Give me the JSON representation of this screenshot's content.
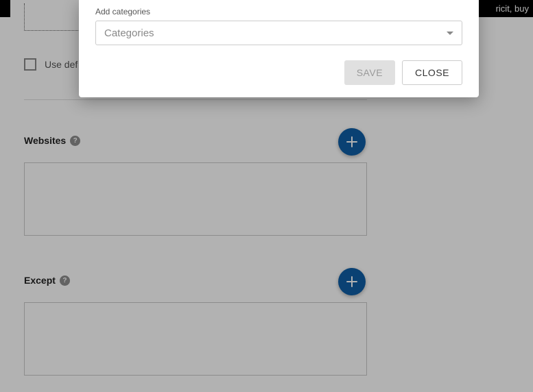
{
  "topbar": {
    "text_fragment": "ricit, buy"
  },
  "background": {
    "checkbox_label": "Use def",
    "sections": {
      "websites": {
        "label": "Websites"
      },
      "except": {
        "label": "Except"
      }
    },
    "help_glyph": "?"
  },
  "dialog": {
    "add_label": "Add categories",
    "select_placeholder": "Categories",
    "save_label": "SAVE",
    "close_label": "CLOSE"
  }
}
